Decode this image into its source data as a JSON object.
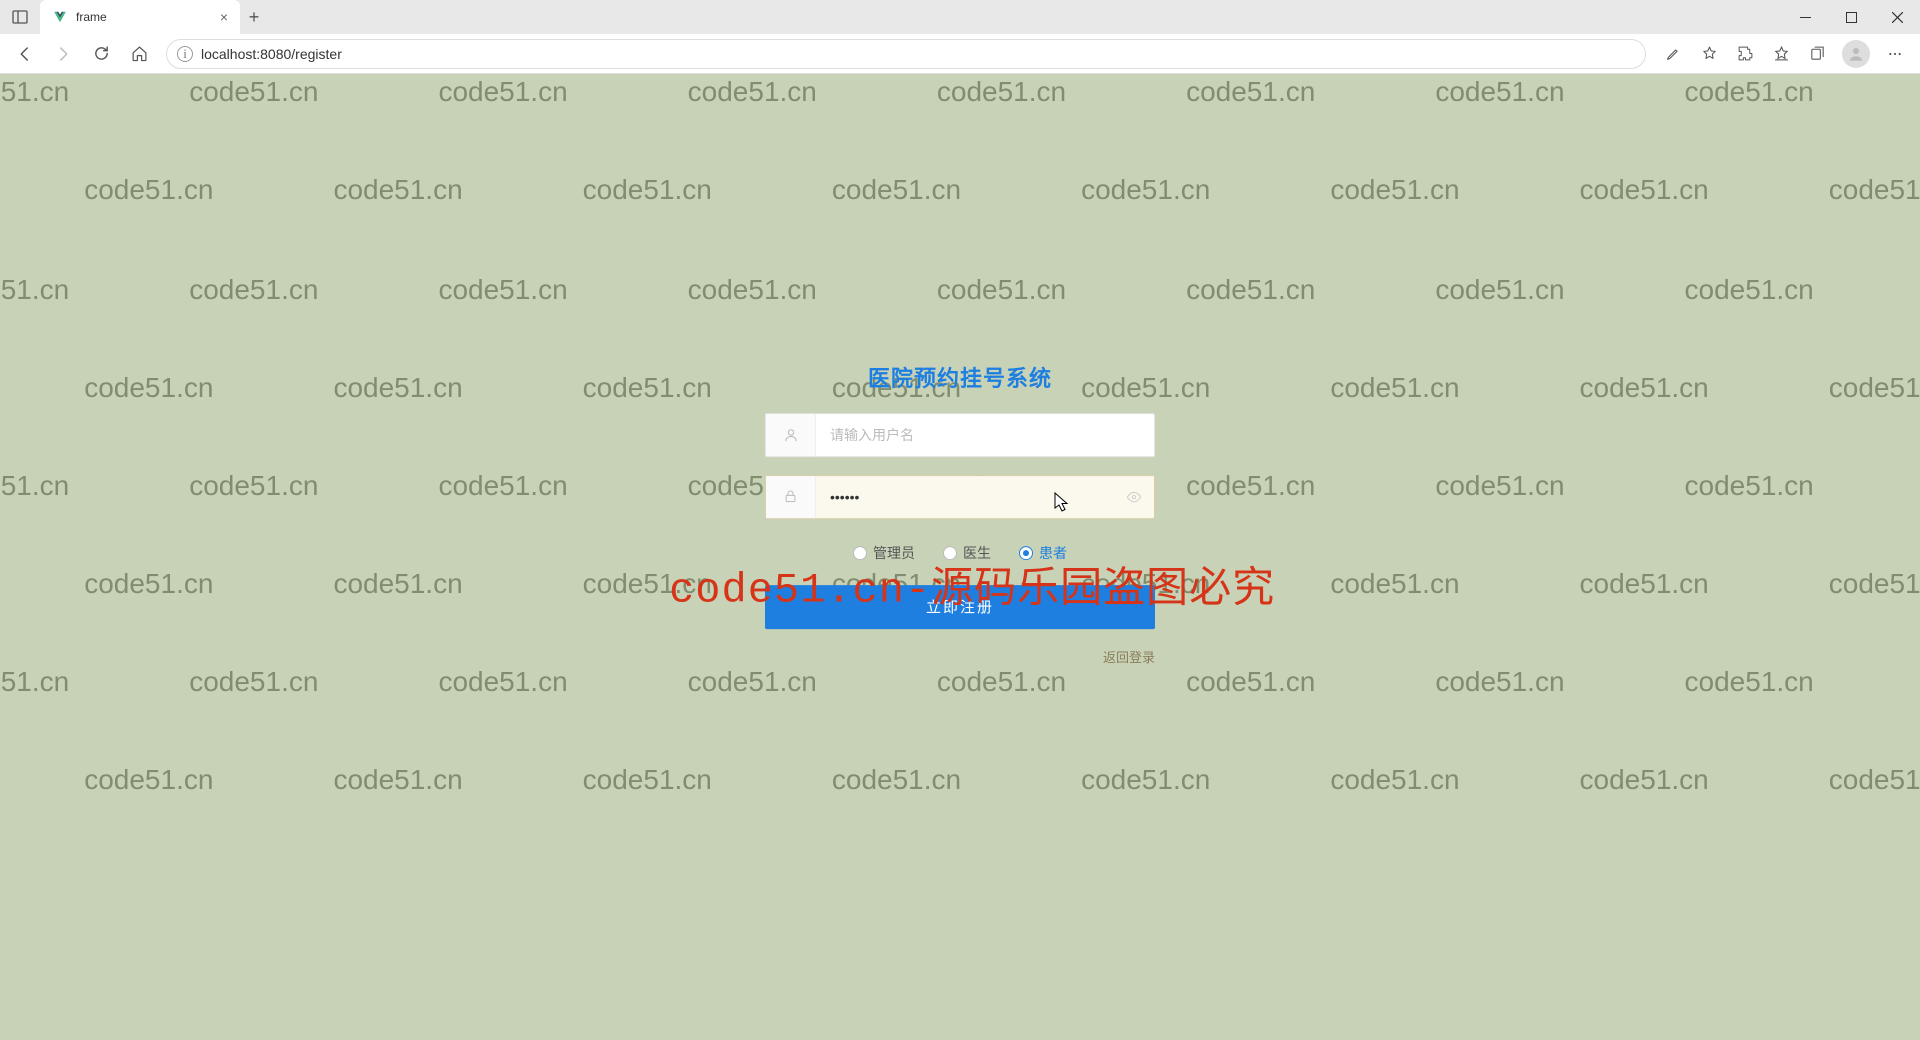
{
  "browser": {
    "tab_title": "frame",
    "url": "localhost:8080/register"
  },
  "watermark": {
    "text": "code51.cn",
    "overlay": "code51.cn-源码乐园盗图必究"
  },
  "register": {
    "title": "医院预约挂号系统",
    "username_placeholder": "请输入用户名",
    "username_value": "",
    "password_value": "······",
    "roles": [
      {
        "key": "admin",
        "label": "管理员",
        "selected": false
      },
      {
        "key": "doctor",
        "label": "医生",
        "selected": false
      },
      {
        "key": "patient",
        "label": "患者",
        "selected": true
      }
    ],
    "submit_label": "立即注册",
    "back_link": "返回登录"
  }
}
